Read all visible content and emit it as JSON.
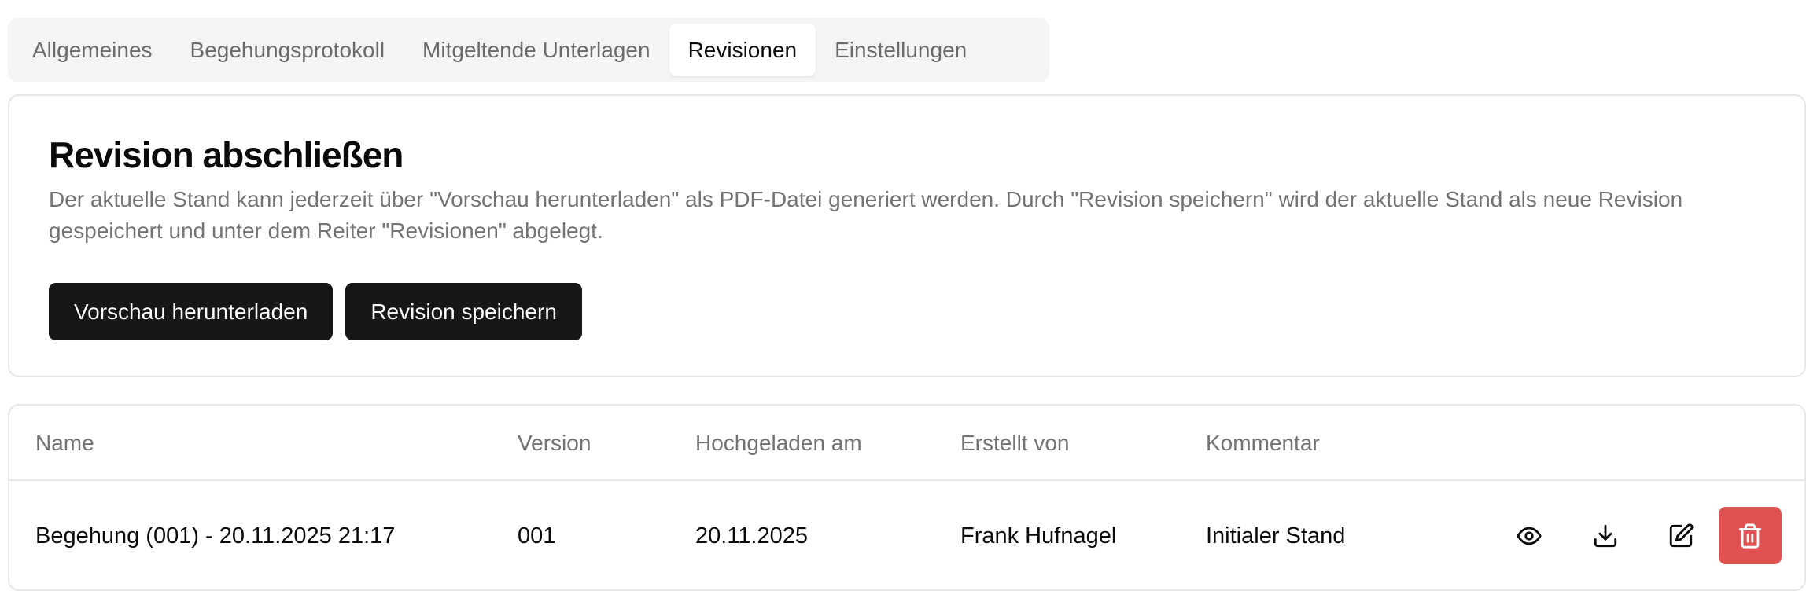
{
  "tabs": [
    {
      "label": "Allgemeines",
      "active": false
    },
    {
      "label": "Begehungsprotokoll",
      "active": false
    },
    {
      "label": "Mitgeltende Unterlagen",
      "active": false
    },
    {
      "label": "Revisionen",
      "active": true
    },
    {
      "label": "Einstellungen",
      "active": false
    }
  ],
  "card": {
    "title": "Revision abschließen",
    "description": "Der aktuelle Stand kann jederzeit über \"Vorschau herunterladen\" als PDF-Datei generiert werden. Durch \"Revision speichern\" wird der aktuelle Stand als neue Revision gespeichert und unter dem Reiter \"Revisionen\" abgelegt.",
    "preview_button": "Vorschau herunterladen",
    "save_button": "Revision speichern"
  },
  "table": {
    "columns": [
      "Name",
      "Version",
      "Hochgeladen am",
      "Erstellt von",
      "Kommentar"
    ],
    "rows": [
      {
        "name": "Begehung (001) - 20.11.2025 21:17",
        "version": "001",
        "uploaded": "20.11.2025",
        "created_by": "Frank Hufnagel",
        "comment": "Initialer Stand"
      }
    ],
    "row_actions": [
      "eye-icon",
      "download-icon",
      "edit-icon",
      "trash-icon"
    ]
  },
  "colors": {
    "primary_button": "#171717",
    "danger": "#e05252",
    "tabs_background": "#f4f4f5",
    "muted_text": "#737373",
    "border": "#e6e6e6"
  }
}
